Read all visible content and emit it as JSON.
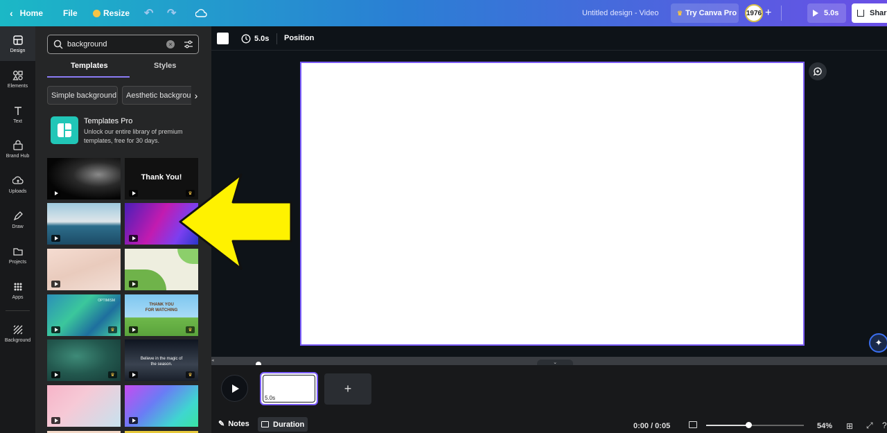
{
  "topbar": {
    "home": "Home",
    "file": "File",
    "resize": "Resize",
    "doc_title": "Untitled design - Video",
    "try_pro": "Try Canva Pro",
    "avatar_text": "1976",
    "play_duration": "5.0s",
    "share": "Share"
  },
  "sidebar": {
    "items": [
      {
        "label": "Design",
        "icon": "design-icon"
      },
      {
        "label": "Elements",
        "icon": "elements-icon"
      },
      {
        "label": "Text",
        "icon": "text-icon"
      },
      {
        "label": "Brand Hub",
        "icon": "brand-hub-icon"
      },
      {
        "label": "Uploads",
        "icon": "uploads-icon"
      },
      {
        "label": "Draw",
        "icon": "draw-icon"
      },
      {
        "label": "Projects",
        "icon": "projects-icon"
      },
      {
        "label": "Apps",
        "icon": "apps-icon"
      },
      {
        "label": "Background",
        "icon": "background-icon"
      }
    ]
  },
  "panel": {
    "search_value": "background",
    "tabs": [
      "Templates",
      "Styles"
    ],
    "chips": [
      "Simple background",
      "Aesthetic background"
    ],
    "promo": {
      "title": "Templates Pro",
      "line1": "Unlock our entire library of premium",
      "line2": "templates, free for 30 days."
    },
    "thumb_texts": {
      "thank_you": "Thank You!",
      "watching_1": "THANK YOU",
      "watching_2": "FOR WATCHING",
      "magic": "Believe in the magic of the season.",
      "optimism": "OPTIMISM"
    }
  },
  "context_bar": {
    "duration": "5.0s",
    "position": "Position"
  },
  "timeline": {
    "clip_duration": "5.0s",
    "notes": "Notes",
    "duration": "Duration",
    "time": "0:00 / 0:05",
    "zoom": "54%"
  },
  "colors": {
    "accent_purple": "#7b5cff",
    "arrow_yellow": "#fff200",
    "crown_gold": "#f6c445"
  }
}
